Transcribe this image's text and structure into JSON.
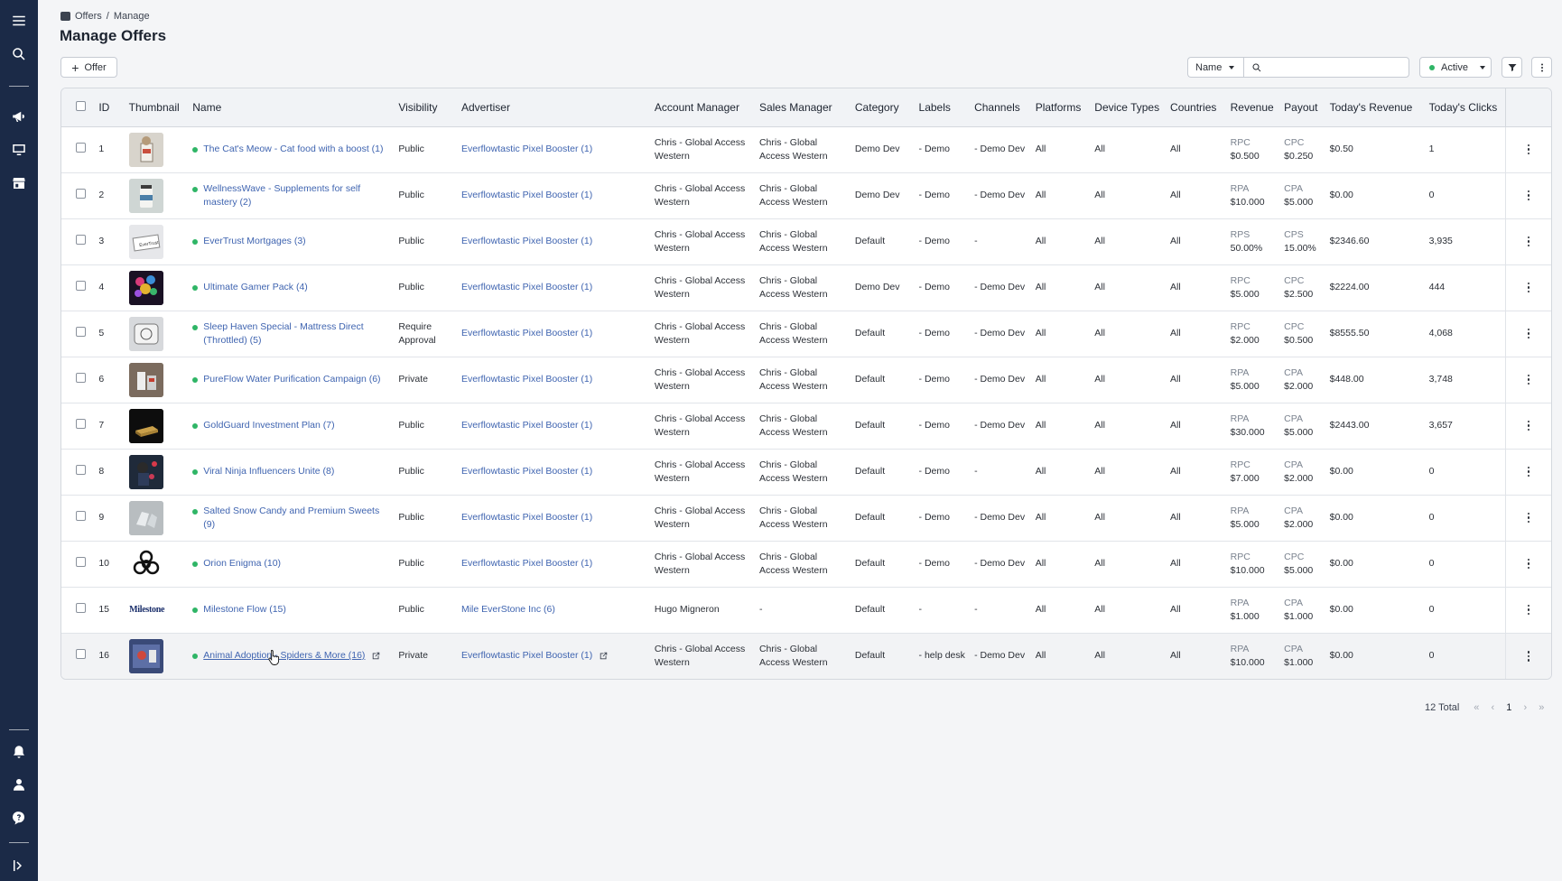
{
  "breadcrumb": {
    "root": "Offers",
    "separator": "/",
    "current": "Manage"
  },
  "page_title": "Manage Offers",
  "toolbar": {
    "add_offer_label": "Offer",
    "search_field_select": "Name",
    "search_placeholder": "",
    "status_select": "Active"
  },
  "colors": {
    "sidebar": "#1b2a47",
    "link": "#3f64b0",
    "active_dot": "#2fb566"
  },
  "table": {
    "headers": {
      "id": "ID",
      "thumbnail": "Thumbnail",
      "name": "Name",
      "visibility": "Visibility",
      "advertiser": "Advertiser",
      "account_manager": "Account Manager",
      "sales_manager": "Sales Manager",
      "category": "Category",
      "labels": "Labels",
      "channels": "Channels",
      "platforms": "Platforms",
      "device_types": "Device Types",
      "countries": "Countries",
      "revenue": "Revenue",
      "payout": "Payout",
      "todays_revenue": "Today's Revenue",
      "todays_clicks": "Today's Clicks"
    },
    "rows": [
      {
        "id": "1",
        "thumb": "cat-food",
        "name": "The Cat's Meow - Cat food with a boost (1)",
        "visibility": "Public",
        "advertiser": "Everflowtastic Pixel Booster (1)",
        "account_manager": "Chris - Global Access Western",
        "sales_manager": "Chris - Global Access Western",
        "category": "Demo Dev",
        "labels": "- Demo",
        "channels": "- Demo Dev",
        "platforms": "All",
        "device_types": "All",
        "countries": "All",
        "revenue_type": "RPC",
        "revenue_value": "$0.500",
        "payout_type": "CPC",
        "payout_value": "$0.250",
        "todays_revenue": "$0.50",
        "todays_clicks": "1"
      },
      {
        "id": "2",
        "thumb": "supplement",
        "name": "WellnessWave - Supplements for self mastery (2)",
        "visibility": "Public",
        "advertiser": "Everflowtastic Pixel Booster (1)",
        "account_manager": "Chris - Global Access Western",
        "sales_manager": "Chris - Global Access Western",
        "category": "Demo Dev",
        "labels": "- Demo",
        "channels": "- Demo Dev",
        "platforms": "All",
        "device_types": "All",
        "countries": "All",
        "revenue_type": "RPA",
        "revenue_value": "$10.000",
        "payout_type": "CPA",
        "payout_value": "$5.000",
        "todays_revenue": "$0.00",
        "todays_clicks": "0"
      },
      {
        "id": "3",
        "thumb": "mortgage",
        "name": "EverTrust Mortgages (3)",
        "visibility": "Public",
        "advertiser": "Everflowtastic Pixel Booster (1)",
        "account_manager": "Chris - Global Access Western",
        "sales_manager": "Chris - Global Access Western",
        "category": "Default",
        "labels": "- Demo",
        "channels": "-",
        "platforms": "All",
        "device_types": "All",
        "countries": "All",
        "revenue_type": "RPS",
        "revenue_value": "50.00%",
        "payout_type": "CPS",
        "payout_value": "15.00%",
        "todays_revenue": "$2346.60",
        "todays_clicks": "3,935"
      },
      {
        "id": "4",
        "thumb": "gamer",
        "name": "Ultimate Gamer Pack (4)",
        "visibility": "Public",
        "advertiser": "Everflowtastic Pixel Booster (1)",
        "account_manager": "Chris - Global Access Western",
        "sales_manager": "Chris - Global Access Western",
        "category": "Demo Dev",
        "labels": "- Demo",
        "channels": "- Demo Dev",
        "platforms": "All",
        "device_types": "All",
        "countries": "All",
        "revenue_type": "RPC",
        "revenue_value": "$5.000",
        "payout_type": "CPC",
        "payout_value": "$2.500",
        "todays_revenue": "$2224.00",
        "todays_clicks": "444"
      },
      {
        "id": "5",
        "thumb": "mattress",
        "name": "Sleep Haven Special - Mattress Direct (Throttled) (5)",
        "visibility": "Require Approval",
        "advertiser": "Everflowtastic Pixel Booster (1)",
        "account_manager": "Chris - Global Access Western",
        "sales_manager": "Chris - Global Access Western",
        "category": "Default",
        "labels": "- Demo",
        "channels": "- Demo Dev",
        "platforms": "All",
        "device_types": "All",
        "countries": "All",
        "revenue_type": "RPC",
        "revenue_value": "$2.000",
        "payout_type": "CPC",
        "payout_value": "$0.500",
        "todays_revenue": "$8555.50",
        "todays_clicks": "4,068"
      },
      {
        "id": "6",
        "thumb": "water",
        "name": "PureFlow Water Purification Campaign (6)",
        "visibility": "Private",
        "advertiser": "Everflowtastic Pixel Booster (1)",
        "account_manager": "Chris - Global Access Western",
        "sales_manager": "Chris - Global Access Western",
        "category": "Default",
        "labels": "- Demo",
        "channels": "- Demo Dev",
        "platforms": "All",
        "device_types": "All",
        "countries": "All",
        "revenue_type": "RPA",
        "revenue_value": "$5.000",
        "payout_type": "CPA",
        "payout_value": "$2.000",
        "todays_revenue": "$448.00",
        "todays_clicks": "3,748"
      },
      {
        "id": "7",
        "thumb": "gold",
        "name": "GoldGuard Investment Plan (7)",
        "visibility": "Public",
        "advertiser": "Everflowtastic Pixel Booster (1)",
        "account_manager": "Chris - Global Access Western",
        "sales_manager": "Chris - Global Access Western",
        "category": "Default",
        "labels": "- Demo",
        "channels": "- Demo Dev",
        "platforms": "All",
        "device_types": "All",
        "countries": "All",
        "revenue_type": "RPA",
        "revenue_value": "$30.000",
        "payout_type": "CPA",
        "payout_value": "$5.000",
        "todays_revenue": "$2443.00",
        "todays_clicks": "3,657"
      },
      {
        "id": "8",
        "thumb": "ninja",
        "name": "Viral Ninja Influencers Unite (8)",
        "visibility": "Public",
        "advertiser": "Everflowtastic Pixel Booster (1)",
        "account_manager": "Chris - Global Access Western",
        "sales_manager": "Chris - Global Access Western",
        "category": "Default",
        "labels": "- Demo",
        "channels": "-",
        "platforms": "All",
        "device_types": "All",
        "countries": "All",
        "revenue_type": "RPC",
        "revenue_value": "$7.000",
        "payout_type": "CPA",
        "payout_value": "$2.000",
        "todays_revenue": "$0.00",
        "todays_clicks": "0"
      },
      {
        "id": "9",
        "thumb": "candy",
        "name": "Salted Snow Candy and Premium Sweets (9)",
        "visibility": "Public",
        "advertiser": "Everflowtastic Pixel Booster (1)",
        "account_manager": "Chris - Global Access Western",
        "sales_manager": "Chris - Global Access Western",
        "category": "Default",
        "labels": "- Demo",
        "channels": "- Demo Dev",
        "platforms": "All",
        "device_types": "All",
        "countries": "All",
        "revenue_type": "RPA",
        "revenue_value": "$5.000",
        "payout_type": "CPA",
        "payout_value": "$2.000",
        "todays_revenue": "$0.00",
        "todays_clicks": "0"
      },
      {
        "id": "10",
        "thumb": "biohazard",
        "name": "Orion Enigma (10)",
        "visibility": "Public",
        "advertiser": "Everflowtastic Pixel Booster (1)",
        "account_manager": "Chris - Global Access Western",
        "sales_manager": "Chris - Global Access Western",
        "category": "Default",
        "labels": "- Demo",
        "channels": "- Demo Dev",
        "platforms": "All",
        "device_types": "All",
        "countries": "All",
        "revenue_type": "RPC",
        "revenue_value": "$10.000",
        "payout_type": "CPC",
        "payout_value": "$5.000",
        "todays_revenue": "$0.00",
        "todays_clicks": "0"
      },
      {
        "id": "15",
        "thumb": "milestone",
        "thumb_text": "Milestone",
        "name": "Milestone Flow (15)",
        "visibility": "Public",
        "advertiser": "Mile EverStone Inc (6)",
        "account_manager": "Hugo Migneron",
        "sales_manager": "-",
        "category": "Default",
        "labels": "-",
        "channels": "-",
        "platforms": "All",
        "device_types": "All",
        "countries": "All",
        "revenue_type": "RPA",
        "revenue_value": "$1.000",
        "payout_type": "CPA",
        "payout_value": "$1.000",
        "todays_revenue": "$0.00",
        "todays_clicks": "0"
      },
      {
        "id": "16",
        "thumb": "spider",
        "name": "Animal Adoption - Spiders & More (16)",
        "visibility": "Private",
        "advertiser": "Everflowtastic Pixel Booster (1)",
        "account_manager": "Chris - Global Access Western",
        "sales_manager": "Chris - Global Access Western",
        "category": "Default",
        "labels": "- help desk",
        "channels": "- Demo Dev",
        "platforms": "All",
        "device_types": "All",
        "countries": "All",
        "revenue_type": "RPA",
        "revenue_value": "$10.000",
        "payout_type": "CPA",
        "payout_value": "$1.000",
        "todays_revenue": "$0.00",
        "todays_clicks": "0",
        "hovered": true
      }
    ]
  },
  "pagination": {
    "total": "12 Total",
    "current_page": "1"
  }
}
